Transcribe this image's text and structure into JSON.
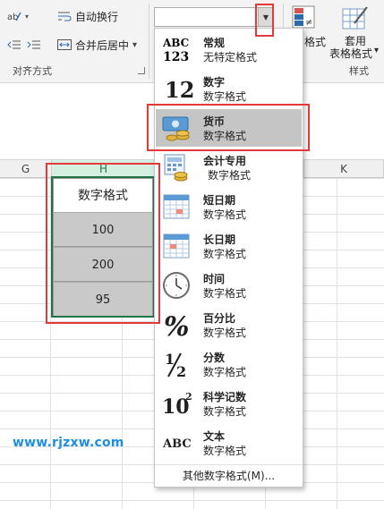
{
  "ribbon": {
    "wrap_text": "自动换行",
    "merge_center": "合并后居中",
    "merge_arrow": "▾",
    "group_alignment": "对齐方式",
    "cond_format_partial": "格式",
    "table_format_line1": "套用",
    "table_format_line2": "表格格式",
    "table_format_arrow": "▾",
    "group_styles": "样式",
    "number_format_value": ""
  },
  "columns": [
    "G",
    "H",
    "K"
  ],
  "cells": {
    "header": "数字格式",
    "values": [
      "100",
      "200",
      "95"
    ]
  },
  "watermark": "www.rjzxw.com",
  "dropdown": {
    "items": [
      {
        "title": "常规",
        "sub": "无特定格式",
        "icon": "general-abc123-icon",
        "glyph": "ABC\n123"
      },
      {
        "title": "数字",
        "sub": "数字格式",
        "icon": "number-12-icon",
        "glyph": "12"
      },
      {
        "title": "货币",
        "sub": "数字格式",
        "icon": "currency-icon",
        "glyph": ""
      },
      {
        "title": "会计专用",
        "sub": "数字格式",
        "icon": "accounting-icon",
        "glyph": ""
      },
      {
        "title": "短日期",
        "sub": "数字格式",
        "icon": "short-date-calendar-icon",
        "glyph": ""
      },
      {
        "title": "长日期",
        "sub": "数字格式",
        "icon": "long-date-calendar-icon",
        "glyph": ""
      },
      {
        "title": "时间",
        "sub": "数字格式",
        "icon": "clock-icon",
        "glyph": ""
      },
      {
        "title": "百分比",
        "sub": "数字格式",
        "icon": "percent-icon",
        "glyph": "%"
      },
      {
        "title": "分数",
        "sub": "数字格式",
        "icon": "fraction-icon",
        "glyph": "½"
      },
      {
        "title": "科学记数",
        "sub": "数字格式",
        "icon": "scientific-icon",
        "glyph": "10²"
      },
      {
        "title": "文本",
        "sub": "数字格式",
        "icon": "text-abc-icon",
        "glyph": "ABC"
      }
    ],
    "highlighted_index": 2,
    "footer": "其他数字格式(M)..."
  },
  "colors": {
    "selection_green": "#217346",
    "annotation_red": "#e63838",
    "highlight_gray": "#c5c5c5",
    "watermark_blue": "#1e8fe0"
  }
}
